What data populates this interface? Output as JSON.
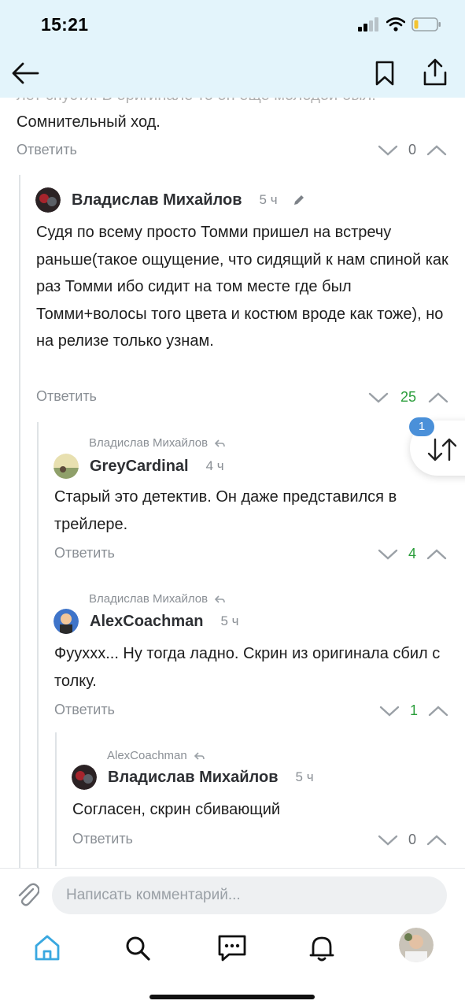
{
  "status_bar": {
    "time": "15:21"
  },
  "top_text": {
    "line1": "лет спустя. В оригинале то он еще молодой был.",
    "line2": "Сомнительный ход."
  },
  "comments": [
    {
      "reply_label": "Ответить",
      "votes": "0"
    },
    {
      "author": "Владислав Михайлов",
      "time": "5 ч",
      "body": "Судя по всему просто Томми пришел на встречу раньше(такое ощущение, что сидящий к нам спиной как раз Томми ибо сидит на том месте где был Томми+волосы того цвета и костюм вроде как тоже), но на релизе только узнам.",
      "reply_label": "Ответить",
      "votes": "25"
    },
    {
      "reply_to": "Владислав Михайлов",
      "author": "GreyCardinal",
      "time": "4 ч",
      "body": "Старый это детектив. Он даже представился в трейлере.",
      "reply_label": "Ответить",
      "votes": "4"
    },
    {
      "reply_to": "Владислав Михайлов",
      "author": "AlexCoachman",
      "time": "5 ч",
      "body": "Фууххх... Ну тогда ладно. Скрин из оригинала сбил с толку.",
      "reply_label": "Ответить",
      "votes": "1"
    },
    {
      "reply_to": "AlexCoachman",
      "author": "Владислав Михайлов",
      "time": "5 ч",
      "body": "Согласен, скрин сбивающий",
      "reply_label": "Ответить",
      "votes": "0"
    }
  ],
  "sort_badge": "1",
  "compose": {
    "placeholder": "Написать комментарий..."
  },
  "colors": {
    "accent": "#4a90d9",
    "positive": "#2a9d3a",
    "header_bg": "#e3f4fb"
  },
  "tabs": [
    "home-icon",
    "search-icon",
    "chat-icon",
    "bell-icon",
    "profile-avatar"
  ]
}
